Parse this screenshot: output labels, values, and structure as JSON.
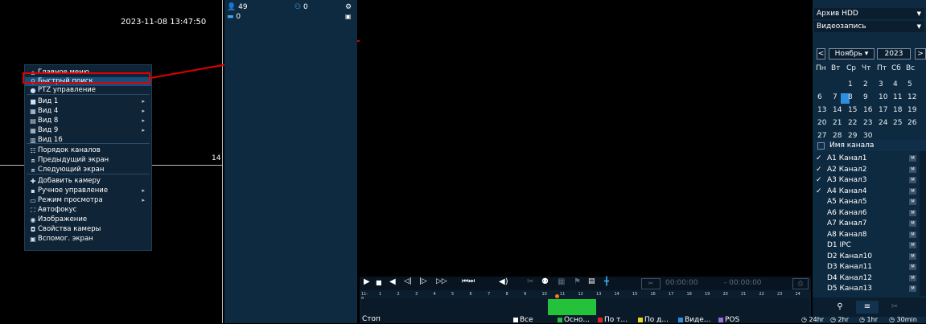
{
  "live": {
    "timestamp": "2023-11-08 13:47:50",
    "channel_number": "14"
  },
  "context_menu": {
    "items": [
      {
        "icon": "home-icon",
        "glyph": "⌂",
        "label": "Главное меню",
        "arrow": ""
      },
      {
        "icon": "search-icon",
        "glyph": "⚲",
        "label": "Быстрый поиск",
        "arrow": ""
      },
      {
        "icon": "ptz-icon",
        "glyph": "●",
        "label": "PTZ управление",
        "arrow": ""
      },
      {
        "icon": "view1-icon",
        "glyph": "■",
        "label": "Вид 1",
        "arrow": "▸"
      },
      {
        "icon": "view4-icon",
        "glyph": "▦",
        "label": "Вид 4",
        "arrow": "▸"
      },
      {
        "icon": "view8-icon",
        "glyph": "▤",
        "label": "Вид 8",
        "arrow": "▸"
      },
      {
        "icon": "view9-icon",
        "glyph": "▦",
        "label": "Вид 9",
        "arrow": "▸"
      },
      {
        "icon": "view16-icon",
        "glyph": "▥",
        "label": "Вид 16",
        "arrow": ""
      },
      {
        "icon": "channel-order-icon",
        "glyph": "☷",
        "label": "Порядок каналов",
        "arrow": ""
      },
      {
        "icon": "prev-screen-icon",
        "glyph": "⧈",
        "label": "Предыдущий экран",
        "arrow": ""
      },
      {
        "icon": "next-screen-icon",
        "glyph": "⧈",
        "label": "Следующий экран",
        "arrow": ""
      },
      {
        "icon": "add-camera-icon",
        "glyph": "✚",
        "label": "Добавить камеру",
        "arrow": ""
      },
      {
        "icon": "manual-control-icon",
        "glyph": "▪",
        "label": "Ручное управление",
        "arrow": "▸"
      },
      {
        "icon": "view-mode-icon",
        "glyph": "▭",
        "label": "Режим просмотра",
        "arrow": "▸"
      },
      {
        "icon": "autofocus-icon",
        "glyph": "⛶",
        "label": "Автофокус",
        "arrow": ""
      },
      {
        "icon": "image-icon",
        "glyph": "◉",
        "label": "Изображение",
        "arrow": ""
      },
      {
        "icon": "camera-props-icon",
        "glyph": "◘",
        "label": "Свойства камеры",
        "arrow": ""
      },
      {
        "icon": "aux-screen-icon",
        "glyph": "▣",
        "label": "Вспомог. экран",
        "arrow": ""
      }
    ]
  },
  "status_panel": {
    "users": "49",
    "people": "0",
    "vehicles": "0"
  },
  "playback": {
    "time_start": "00:00:00",
    "time_end": "- 00:00:00",
    "timeline_ticks": [
      "1",
      "2",
      "3",
      "4",
      "5",
      "6",
      "7",
      "8",
      "9",
      "10",
      "11",
      "12",
      "13",
      "14",
      "15",
      "16",
      "17",
      "18",
      "19",
      "20",
      "21",
      "22",
      "23",
      "24"
    ],
    "timeline_first": "11-8",
    "status_text": "Стоп"
  },
  "filters": [
    {
      "label": "Все",
      "color": "#ffffff"
    },
    {
      "label": "Осно...",
      "color": "#23c23a"
    },
    {
      "label": "По т...",
      "color": "#e02424"
    },
    {
      "label": "По д...",
      "color": "#e8d81c"
    },
    {
      "label": "Виде...",
      "color": "#2d8fe0"
    },
    {
      "label": "POS",
      "color": "#9a6ee0"
    }
  ],
  "periods": [
    "24hr",
    "2hr",
    "1hr",
    "30min"
  ],
  "right_panel": {
    "source": "Архив HDD",
    "record_type": "Видеозапись",
    "month": "Ноябрь",
    "year": "2023",
    "weekdays": [
      "Пн",
      "Вт",
      "Ср",
      "Чт",
      "Пт",
      "Сб",
      "Вс"
    ],
    "days": [
      [
        "",
        "",
        "1",
        "2",
        "3",
        "4",
        "5"
      ],
      [
        "6",
        "7",
        "8",
        "9",
        "10",
        "11",
        "12"
      ],
      [
        "13",
        "14",
        "15",
        "16",
        "17",
        "18",
        "19"
      ],
      [
        "20",
        "21",
        "22",
        "23",
        "24",
        "25",
        "26"
      ],
      [
        "27",
        "28",
        "29",
        "30",
        "",
        "",
        ""
      ]
    ],
    "selected_day": "8",
    "channel_header": "Имя канала",
    "channels": [
      {
        "checked": true,
        "name": "A1 Канал1"
      },
      {
        "checked": true,
        "name": "A2 Канал2"
      },
      {
        "checked": true,
        "name": "A3 Канал3"
      },
      {
        "checked": true,
        "name": "A4 Канал4"
      },
      {
        "checked": false,
        "name": "A5 Канал5"
      },
      {
        "checked": false,
        "name": "A6 Канал6"
      },
      {
        "checked": false,
        "name": "A7 Канал7"
      },
      {
        "checked": false,
        "name": "A8 Канал8"
      },
      {
        "checked": false,
        "name": "D1 IPC"
      },
      {
        "checked": false,
        "name": "D2 Канал10"
      },
      {
        "checked": false,
        "name": "D3 Канал11"
      },
      {
        "checked": false,
        "name": "D4 Канал12"
      },
      {
        "checked": false,
        "name": "D5 Канал13"
      }
    ],
    "main_stream_badge": "M"
  },
  "colors": {
    "panel": "#0e2a40",
    "highlight": "#e00000",
    "accent": "#2d8fe0"
  }
}
